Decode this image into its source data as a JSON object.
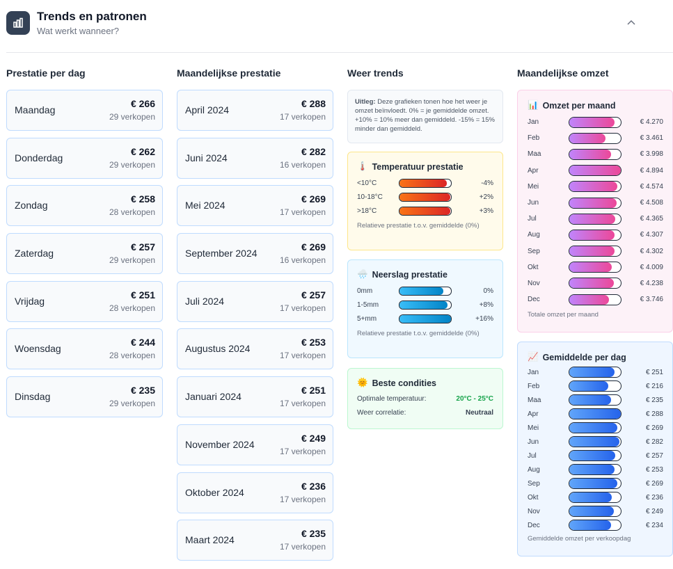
{
  "header": {
    "title": "Trends en patronen",
    "subtitle": "Wat werkt wanneer?"
  },
  "day_performance": {
    "title": "Prestatie per dag",
    "items": [
      {
        "name": "Maandag",
        "amount": "€ 266",
        "count": "29 verkopen"
      },
      {
        "name": "Donderdag",
        "amount": "€ 262",
        "count": "29 verkopen"
      },
      {
        "name": "Zondag",
        "amount": "€ 258",
        "count": "28 verkopen"
      },
      {
        "name": "Zaterdag",
        "amount": "€ 257",
        "count": "29 verkopen"
      },
      {
        "name": "Vrijdag",
        "amount": "€ 251",
        "count": "28 verkopen"
      },
      {
        "name": "Woensdag",
        "amount": "€ 244",
        "count": "28 verkopen"
      },
      {
        "name": "Dinsdag",
        "amount": "€ 235",
        "count": "29 verkopen"
      }
    ]
  },
  "month_performance": {
    "title": "Maandelijkse prestatie",
    "items": [
      {
        "name": "April 2024",
        "amount": "€ 288",
        "count": "17 verkopen"
      },
      {
        "name": "Juni 2024",
        "amount": "€ 282",
        "count": "16 verkopen"
      },
      {
        "name": "Mei 2024",
        "amount": "€ 269",
        "count": "17 verkopen"
      },
      {
        "name": "September 2024",
        "amount": "€ 269",
        "count": "16 verkopen"
      },
      {
        "name": "Juli 2024",
        "amount": "€ 257",
        "count": "17 verkopen"
      },
      {
        "name": "Augustus 2024",
        "amount": "€ 253",
        "count": "17 verkopen"
      },
      {
        "name": "Januari 2024",
        "amount": "€ 251",
        "count": "17 verkopen"
      },
      {
        "name": "November 2024",
        "amount": "€ 249",
        "count": "17 verkopen"
      },
      {
        "name": "Oktober 2024",
        "amount": "€ 236",
        "count": "17 verkopen"
      },
      {
        "name": "Maart 2024",
        "amount": "€ 235",
        "count": "17 verkopen"
      }
    ]
  },
  "weather": {
    "title": "Weer trends",
    "legend_bold": "Uitleg:",
    "legend_text": " Deze grafieken tonen hoe het weer je omzet beïnvloedt. 0% = je gemiddelde omzet. +10% = 10% meer dan gemiddeld. -15% = 15% minder dan gemiddeld.",
    "temperature": {
      "icon": "🌡️",
      "title": "Temperatuur prestatie",
      "rows": [
        {
          "label": "<10°C",
          "pct": "-4%",
          "fill": 0.92
        },
        {
          "label": "10-18°C",
          "pct": "+2%",
          "fill": 0.98
        },
        {
          "label": ">18°C",
          "pct": "+3%",
          "fill": 0.99
        }
      ],
      "note": "Relatieve prestatie t.o.v. gemiddelde (0%)",
      "gradient": [
        "#f97316",
        "#dc2626"
      ]
    },
    "precipitation": {
      "icon": "🌧️",
      "title": "Neerslag prestatie",
      "rows": [
        {
          "label": "0mm",
          "pct": "0%",
          "fill": 0.85
        },
        {
          "label": "1-5mm",
          "pct": "+8%",
          "fill": 0.93
        },
        {
          "label": "5+mm",
          "pct": "+16%",
          "fill": 1.0
        }
      ],
      "note": "Relatieve prestatie t.o.v. gemiddelde (0%)",
      "gradient": [
        "#38bdf8",
        "#0284c7"
      ]
    },
    "best": {
      "icon": "🌞",
      "title": "Beste condities",
      "temp_label": "Optimale temperatuur:",
      "temp_value": "20°C - 25°C",
      "corr_label": "Weer correlatie:",
      "corr_value": "Neutraal"
    }
  },
  "monthly_revenue": {
    "title": "Maandelijkse omzet",
    "revenue": {
      "icon": "📊",
      "title": "Omzet per maand",
      "footer": "Totale omzet per maand",
      "max": 4894,
      "gradient": [
        "#c084fc",
        "#ec4899"
      ],
      "rows": [
        {
          "month": "Jan",
          "value": 4270,
          "label": "€ 4.270"
        },
        {
          "month": "Feb",
          "value": 3461,
          "label": "€ 3.461"
        },
        {
          "month": "Maa",
          "value": 3998,
          "label": "€ 3.998"
        },
        {
          "month": "Apr",
          "value": 4894,
          "label": "€ 4.894"
        },
        {
          "month": "Mei",
          "value": 4574,
          "label": "€ 4.574"
        },
        {
          "month": "Jun",
          "value": 4508,
          "label": "€ 4.508"
        },
        {
          "month": "Jul",
          "value": 4365,
          "label": "€ 4.365"
        },
        {
          "month": "Aug",
          "value": 4307,
          "label": "€ 4.307"
        },
        {
          "month": "Sep",
          "value": 4302,
          "label": "€ 4.302"
        },
        {
          "month": "Okt",
          "value": 4009,
          "label": "€ 4.009"
        },
        {
          "month": "Nov",
          "value": 4238,
          "label": "€ 4.238"
        },
        {
          "month": "Dec",
          "value": 3746,
          "label": "€ 3.746"
        }
      ]
    },
    "per_day": {
      "icon": "📈",
      "title": "Gemiddelde per dag",
      "footer": "Gemiddelde omzet per verkoopdag",
      "max": 288,
      "gradient": [
        "#60a5fa",
        "#2563eb"
      ],
      "rows": [
        {
          "month": "Jan",
          "value": 251,
          "label": "€ 251"
        },
        {
          "month": "Feb",
          "value": 216,
          "label": "€ 216"
        },
        {
          "month": "Maa",
          "value": 235,
          "label": "€ 235"
        },
        {
          "month": "Apr",
          "value": 288,
          "label": "€ 288"
        },
        {
          "month": "Mei",
          "value": 269,
          "label": "€ 269"
        },
        {
          "month": "Jun",
          "value": 282,
          "label": "€ 282"
        },
        {
          "month": "Jul",
          "value": 257,
          "label": "€ 257"
        },
        {
          "month": "Aug",
          "value": 253,
          "label": "€ 253"
        },
        {
          "month": "Sep",
          "value": 269,
          "label": "€ 269"
        },
        {
          "month": "Okt",
          "value": 236,
          "label": "€ 236"
        },
        {
          "month": "Nov",
          "value": 249,
          "label": "€ 249"
        },
        {
          "month": "Dec",
          "value": 234,
          "label": "€ 234"
        }
      ]
    }
  }
}
